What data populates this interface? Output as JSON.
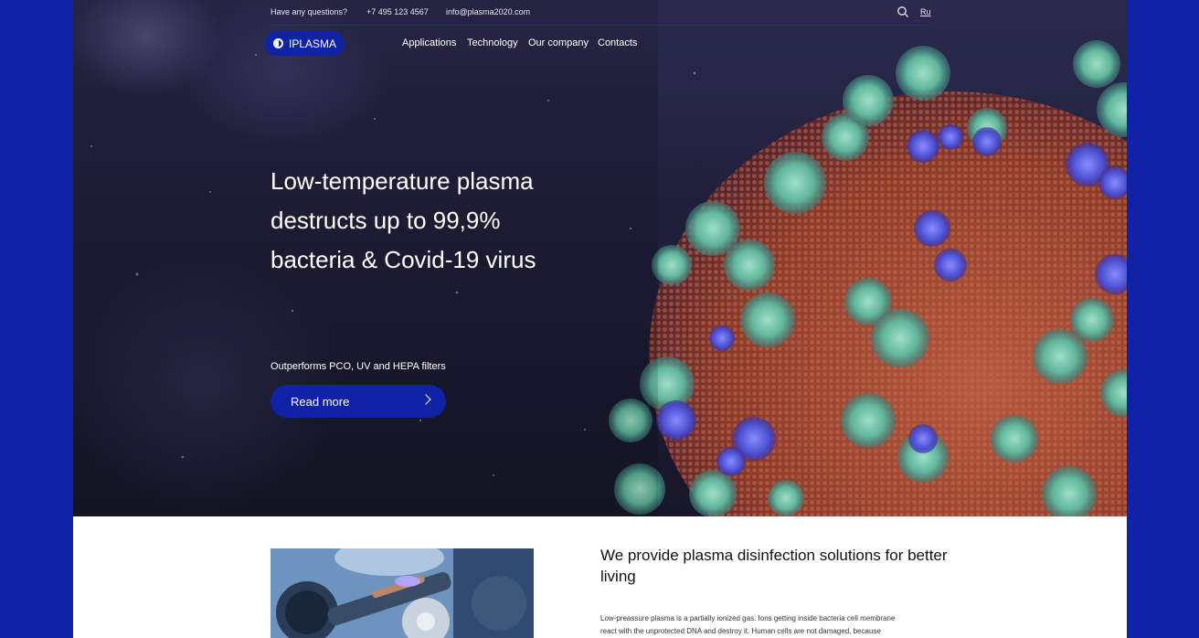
{
  "topbar": {
    "question": "Have any questions?",
    "phone": "+7 495 123 4567",
    "email": "info@plasma2020.com",
    "language": "Ru"
  },
  "logo": {
    "text": "IPLASMA"
  },
  "nav": {
    "items": [
      "Applications",
      "Technology",
      "Our company",
      "Contacts"
    ]
  },
  "hero": {
    "headline_lines": [
      "Low-temperature plasma",
      "destructs up to 99,9%",
      "bacteria & Covid-19 virus"
    ],
    "subline": "Outperforms PCO, UV and HEPA filters",
    "cta_label": "Read more"
  },
  "section": {
    "title": "We provide plasma disinfection solutions for better living",
    "body_lines": [
      "Low-preassure plasma is a partially ionized gas. Ions getting inside bacteria cell membrane",
      "react with the unprotected DNA and destroy it. Human cells are not damaged, because"
    ]
  },
  "colors": {
    "brand": "#1023a6",
    "hero_bg": "#1f1f3a",
    "page_bg": "#ffffff"
  }
}
